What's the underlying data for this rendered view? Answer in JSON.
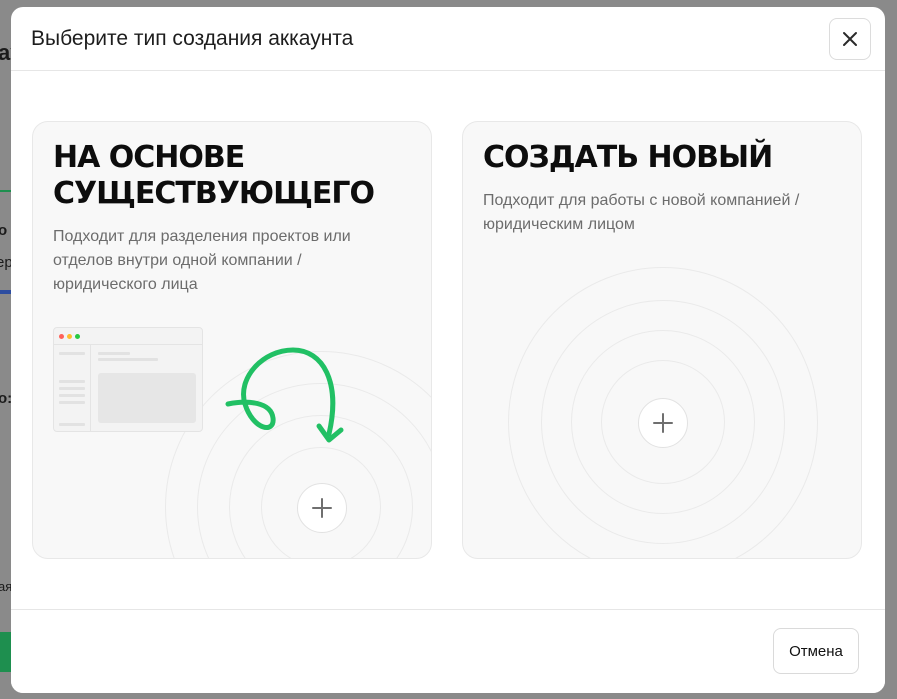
{
  "background": {
    "fragments": [
      "ay",
      "o",
      "ер",
      "o:",
      "ая"
    ]
  },
  "modal": {
    "title": "Выберите тип создания аккаунта",
    "close_icon": "close-icon"
  },
  "cards": [
    {
      "title_line1": "На основе",
      "title_line2": "существующего",
      "description": "Подходит для разделения проектов или отделов внутри одной компании / юридического лица",
      "plus_icon": "plus-icon",
      "accent_color": "#21c064"
    },
    {
      "title_line1": "Создать новый",
      "description": "Подходит для работы с новой компанией / юридическим лицом",
      "plus_icon": "plus-icon"
    }
  ],
  "footer": {
    "cancel_label": "Отмена"
  }
}
